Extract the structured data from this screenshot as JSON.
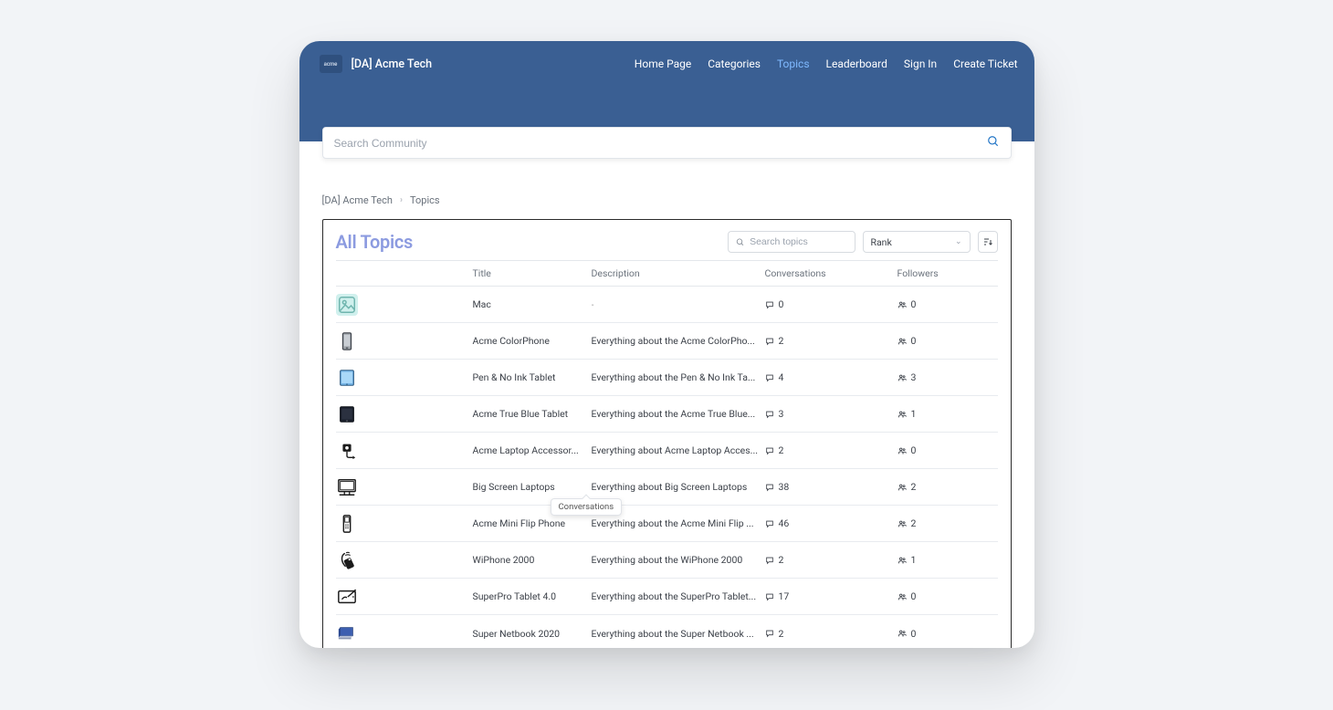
{
  "site": {
    "logo_text": "acme",
    "title": "[DA] Acme Tech"
  },
  "nav": {
    "home": "Home Page",
    "categories": "Categories",
    "topics": "Topics",
    "leaderboard": "Leaderboard",
    "signin": "Sign In",
    "create_ticket": "Create Ticket"
  },
  "search": {
    "placeholder": "Search Community"
  },
  "breadcrumb": {
    "root": "[DA] Acme Tech",
    "current": "Topics"
  },
  "panel": {
    "title": "All Topics",
    "search_placeholder": "Search topics",
    "sort_label": "Rank",
    "tooltip": "Conversations"
  },
  "columns": {
    "title": "Title",
    "description": "Description",
    "conversations": "Conversations",
    "followers": "Followers"
  },
  "rows": [
    {
      "title": "Mac",
      "desc": "-",
      "conversations": "0",
      "followers": "0",
      "icon": "placeholder"
    },
    {
      "title": "Acme ColorPhone",
      "desc": "Everything about the Acme ColorPho...",
      "conversations": "2",
      "followers": "0",
      "icon": "phone"
    },
    {
      "title": "Pen & No Ink Tablet",
      "desc": "Everything about the Pen & No Ink Ta...",
      "conversations": "4",
      "followers": "3",
      "icon": "tablet-blue"
    },
    {
      "title": "Acme True Blue Tablet",
      "desc": "Everything about the Acme True Blue...",
      "conversations": "3",
      "followers": "1",
      "icon": "tablet-dark"
    },
    {
      "title": "Acme Laptop Accessor...",
      "desc": "Everything about Acme Laptop Acces...",
      "conversations": "2",
      "followers": "0",
      "icon": "accessory"
    },
    {
      "title": "Big Screen Laptops",
      "desc": "Everything about Big Screen Laptops",
      "conversations": "38",
      "followers": "2",
      "icon": "monitor"
    },
    {
      "title": "Acme Mini Flip Phone",
      "desc": "Everything about the Acme Mini Flip ...",
      "conversations": "46",
      "followers": "2",
      "icon": "flip-phone"
    },
    {
      "title": "WiPhone 2000",
      "desc": "Everything about the WiPhone 2000",
      "conversations": "2",
      "followers": "1",
      "icon": "wiphone"
    },
    {
      "title": "SuperPro Tablet 4.0",
      "desc": "Everything about the SuperPro Tablet...",
      "conversations": "17",
      "followers": "0",
      "icon": "pro-tablet"
    },
    {
      "title": "Super Netbook 2020",
      "desc": "Everything about the Super Netbook ...",
      "conversations": "2",
      "followers": "0",
      "icon": "netbook"
    }
  ]
}
